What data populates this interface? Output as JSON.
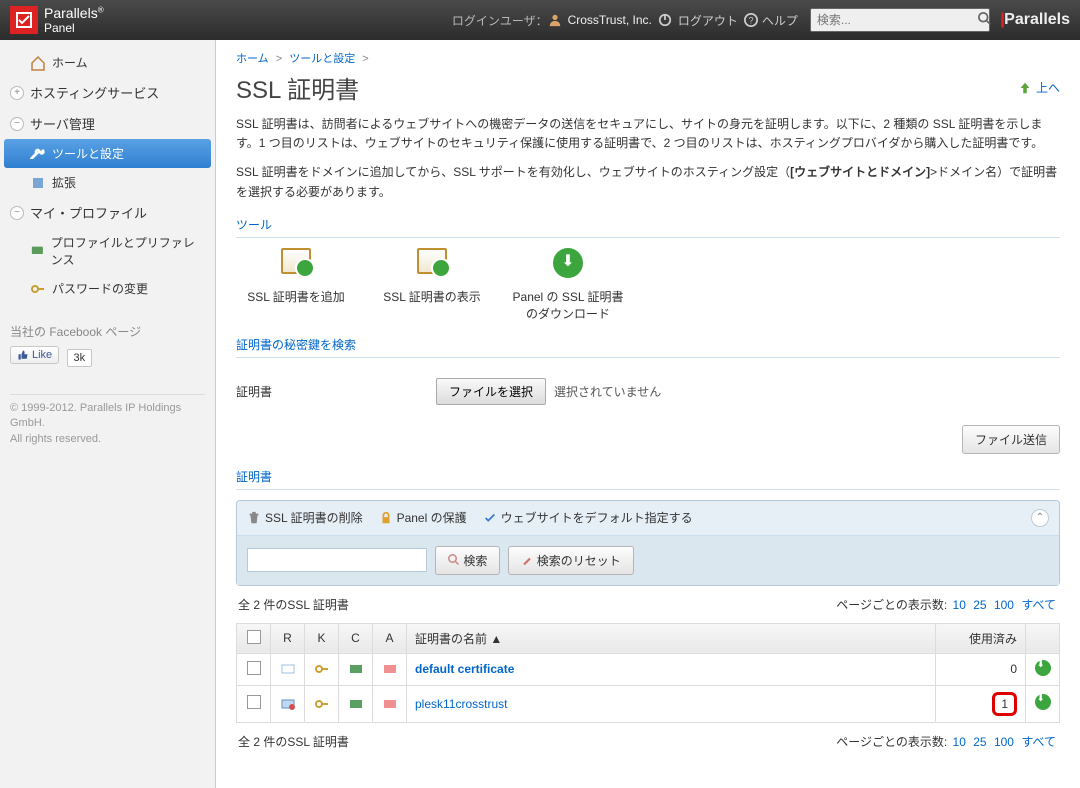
{
  "header": {
    "product": "Parallels",
    "product_sub": "Panel",
    "login_label": "ログインユーザ：",
    "user": "CrossTrust, Inc.",
    "logout": "ログアウト",
    "help": "ヘルプ",
    "search_placeholder": "検索...",
    "brand2": "Parallels"
  },
  "sidebar": {
    "home": "ホーム",
    "hosting": "ホスティングサービス",
    "server": "サーバ管理",
    "tools": "ツールと設定",
    "extend": "拡張",
    "profile": "マイ・プロファイル",
    "pref": "プロファイルとプリファレンス",
    "password": "パスワードの変更",
    "fb_title": "当社の Facebook ページ",
    "fb_like": "Like",
    "fb_count": "3k",
    "copyright1": "© 1999-2012. Parallels IP Holdings GmbH.",
    "copyright2": "All rights reserved."
  },
  "breadcrumb": {
    "home": "ホーム",
    "tools": "ツールと設定"
  },
  "page": {
    "title": "SSL 証明書",
    "up": "上へ",
    "desc1": "SSL 証明書は、訪問者によるウェブサイトへの機密データの送信をセキュアにし、サイトの身元を証明します。以下に、2 種類の SSL 証明書を示します。1 つ目のリストは、ウェブサイトのセキュリティ保護に使用する証明書で、2 つ目のリストは、ホスティングプロバイダから購入した証明書です。",
    "desc2a": "SSL 証明書をドメインに追加してから、SSL サポートを有効化し、ウェブサイトのホスティング設定（",
    "desc2b": "[ウェブサイトとドメイン]",
    "desc2c": ">ドメイン名）で証明書を選択する必要があります。",
    "tools_title": "ツール",
    "tool_add": "SSL 証明書を追加",
    "tool_show": "SSL 証明書の表示",
    "tool_dl": "Panel の SSL 証明書のダウンロード",
    "key_title": "証明書の秘密鍵を検索",
    "cert_label": "証明書",
    "file_btn": "ファイルを選択",
    "file_status": "選択されていません",
    "submit": "ファイル送信",
    "list_title": "証明書"
  },
  "listbar": {
    "delete": "SSL 証明書の削除",
    "protect": "Panel の保護",
    "default": "ウェブサイトをデフォルト指定する",
    "search": "検索",
    "reset": "検索のリセット"
  },
  "count": {
    "text": "全 2 件のSSL 証明書",
    "pager_label": "ページごとの表示数:",
    "p10": "10",
    "p25": "25",
    "p100": "100",
    "pall": "すべて"
  },
  "table": {
    "c_r": "R",
    "c_k": "K",
    "c_c": "C",
    "c_a": "A",
    "c_name": "証明書の名前",
    "c_used": "使用済み",
    "rows": [
      {
        "name": "default certificate",
        "used": "0"
      },
      {
        "name": "plesk11crosstrust",
        "used": "1"
      }
    ]
  }
}
